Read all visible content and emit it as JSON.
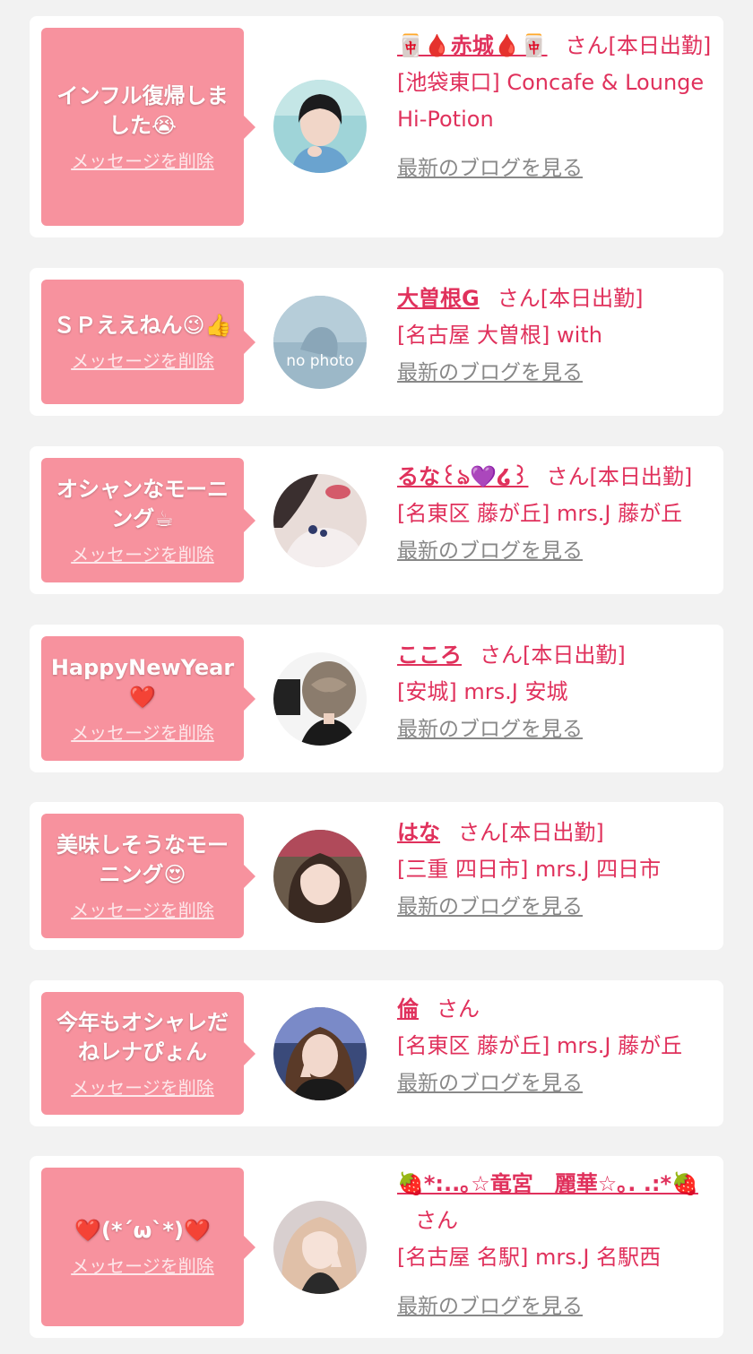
{
  "messages": [
    {
      "message": "インフル復帰しました😭",
      "delete_label": "メッセージを削除",
      "name": "🀄🩸赤城🩸🀄",
      "honorific": "さん",
      "status": "[本日出勤]",
      "shop": "[池袋東口] Concafe & Lounge Hi-Potion",
      "blog_label": "最新のブログを見る",
      "avatar": "short-black-hair-woman-photo"
    },
    {
      "message": "ＳＰええねん😉👍",
      "delete_label": "メッセージを削除",
      "name": "大曽根G",
      "honorific": "さん",
      "status": "[本日出勤]",
      "shop": "[名古屋 大曽根] with",
      "blog_label": "最新のブログを見る",
      "avatar": "no-photo-placeholder",
      "avatar_text": "no photo"
    },
    {
      "message": "オシャンなモーニング☕",
      "delete_label": "メッセージを削除",
      "name": "るな꒰ঌ💜໒꒱",
      "honorific": "さん",
      "status": "[本日出勤]",
      "shop": "[名東区 藤が丘] mrs.J 藤が丘",
      "blog_label": "最新のブログを見る",
      "avatar": "woman-white-lace-photo"
    },
    {
      "message": "HappyNewYear❤️",
      "delete_label": "メッセージを削除",
      "name": "こころ",
      "honorific": "さん",
      "status": "[本日出勤]",
      "shop": "[安城] mrs.J 安城",
      "blog_label": "最新のブログを見る",
      "avatar": "braided-hair-back-photo"
    },
    {
      "message": "美味しそうなモーニング😍",
      "delete_label": "メッセージを削除",
      "name": "はな",
      "honorific": "さん",
      "status": "[本日出勤]",
      "shop": "[三重 四日市] mrs.J 四日市",
      "blog_label": "最新のブログを見る",
      "avatar": "woman-portrait-photo"
    },
    {
      "message": "今年もオシャレだねレナぴょん",
      "delete_label": "メッセージを削除",
      "name": "倫",
      "honorific": "さん",
      "status": "",
      "shop": "[名東区 藤が丘] mrs.J 藤が丘",
      "blog_label": "最新のブログを見る",
      "avatar": "peace-sign-woman-photo"
    },
    {
      "message": "❤️(*´ω`*)❤️",
      "delete_label": "メッセージを削除",
      "name": "🍓*:..｡☆竜宮　麗華☆｡. .:*🍓",
      "honorific": "さん",
      "status": "",
      "shop": "[名古屋 名駅] mrs.J 名駅西",
      "blog_label": "最新のブログを見る",
      "avatar": "blonde-woman-photo"
    }
  ],
  "colors": {
    "background": "#f2f2f2",
    "card": "#ffffff",
    "bubble": "#f7929e",
    "accent_text": "#e0315c",
    "link_gray": "#888888"
  }
}
